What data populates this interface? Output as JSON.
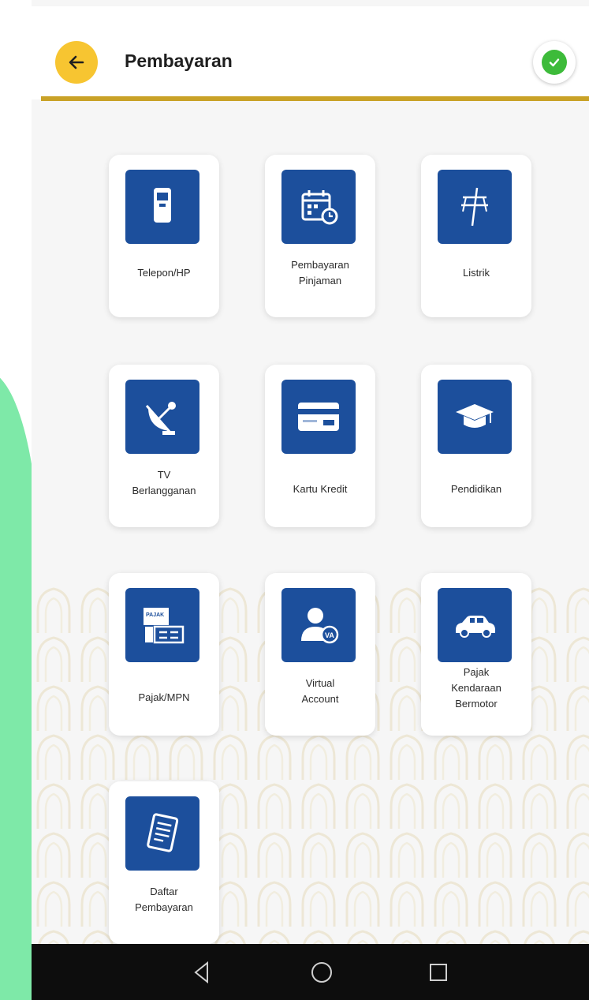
{
  "app": {
    "title": "Pembayaran"
  },
  "colors": {
    "accent_yellow": "#f7c531",
    "gold_line": "#c9a227",
    "tile_blue": "#1c4f9c",
    "status_green": "#3dbb3a",
    "background_green": "#7ee9a8"
  },
  "menu": {
    "items": [
      {
        "label": "Telepon/HP",
        "icon": "smartphone-icon"
      },
      {
        "label": "Pembayaran\nPinjaman",
        "icon": "calendar-payment-icon"
      },
      {
        "label": "Listrik",
        "icon": "electricity-icon"
      },
      {
        "label": "TV\nBerlangganan",
        "icon": "satellite-dish-icon"
      },
      {
        "label": "Kartu Kredit",
        "icon": "credit-card-icon"
      },
      {
        "label": "Pendidikan",
        "icon": "graduation-cap-icon"
      },
      {
        "label": "Pajak/MPN",
        "icon": "tax-document-icon"
      },
      {
        "label": "Virtual\nAccount",
        "icon": "virtual-account-icon"
      },
      {
        "label": "Pajak\nKendaraan\nBermotor",
        "icon": "car-icon"
      },
      {
        "label": "Daftar\nPembayaran",
        "icon": "payment-list-icon"
      }
    ]
  },
  "navigation": {
    "buttons": [
      "back-nav-icon",
      "home-nav-icon",
      "recents-nav-icon"
    ]
  }
}
